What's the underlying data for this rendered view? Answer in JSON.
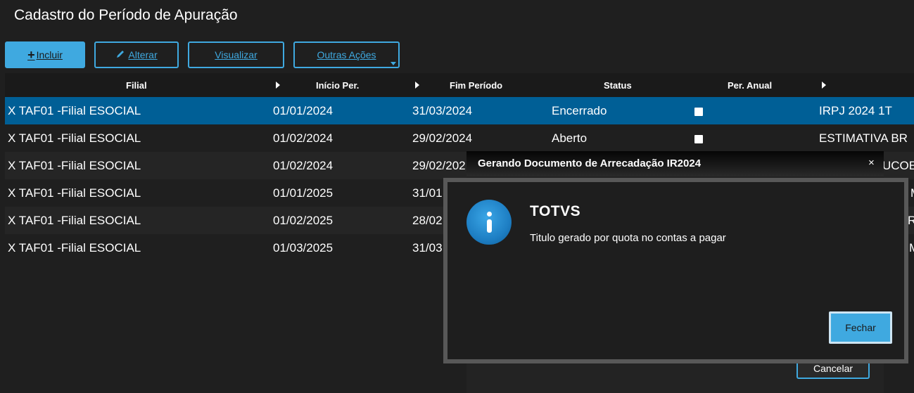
{
  "page": {
    "title": "Cadastro do Período de Apuração"
  },
  "toolbar": {
    "incluir": "Incluir",
    "alterar": "Alterar",
    "visualizar": "Visualizar",
    "outras_acoes": "Outras Ações"
  },
  "grid": {
    "columns": [
      "Filial",
      "Início Per.",
      "Fim Período",
      "Status",
      "Per. Anual"
    ],
    "rows": [
      {
        "filial": "X TAF01 -Filial ESOCIAL",
        "inicio": "01/01/2024",
        "fim": "31/03/2024",
        "status": "Encerrado",
        "descricao": "IRPJ 2024 1T"
      },
      {
        "filial": "X TAF01 -Filial ESOCIAL",
        "inicio": "01/02/2024",
        "fim": "29/02/2024",
        "status": "Aberto",
        "descricao": "ESTIMATIVA BR"
      },
      {
        "filial": "X TAF01 -Filial ESOCIAL",
        "inicio": "01/02/2024",
        "fim": "29/02/202",
        "status": "",
        "descricao": "UCOE"
      },
      {
        "filial": "X TAF01 -Filial ESOCIAL",
        "inicio": "01/01/2025",
        "fim": "31/01",
        "status": "",
        "descricao": "M"
      },
      {
        "filial": "X TAF01 -Filial ESOCIAL",
        "inicio": "01/02/2025",
        "fim": "28/02",
        "status": "",
        "descricao": "R"
      },
      {
        "filial": "X TAF01 -Filial ESOCIAL",
        "inicio": "01/03/2025",
        "fim": "31/03",
        "status": "",
        "descricao": "M"
      }
    ]
  },
  "back_dialog": {
    "title": "Gerando Documento de Arrecadação IR2024",
    "close": "×",
    "cancel": "Cancelar"
  },
  "message_dialog": {
    "icon": "info-icon",
    "title": "TOTVS",
    "text": "Titulo gerado por quota no contas a pagar",
    "close_button": "Fechar"
  },
  "colors": {
    "accent": "#3fa9e0",
    "selected_row": "#005f96",
    "background": "#1f1f1f"
  }
}
